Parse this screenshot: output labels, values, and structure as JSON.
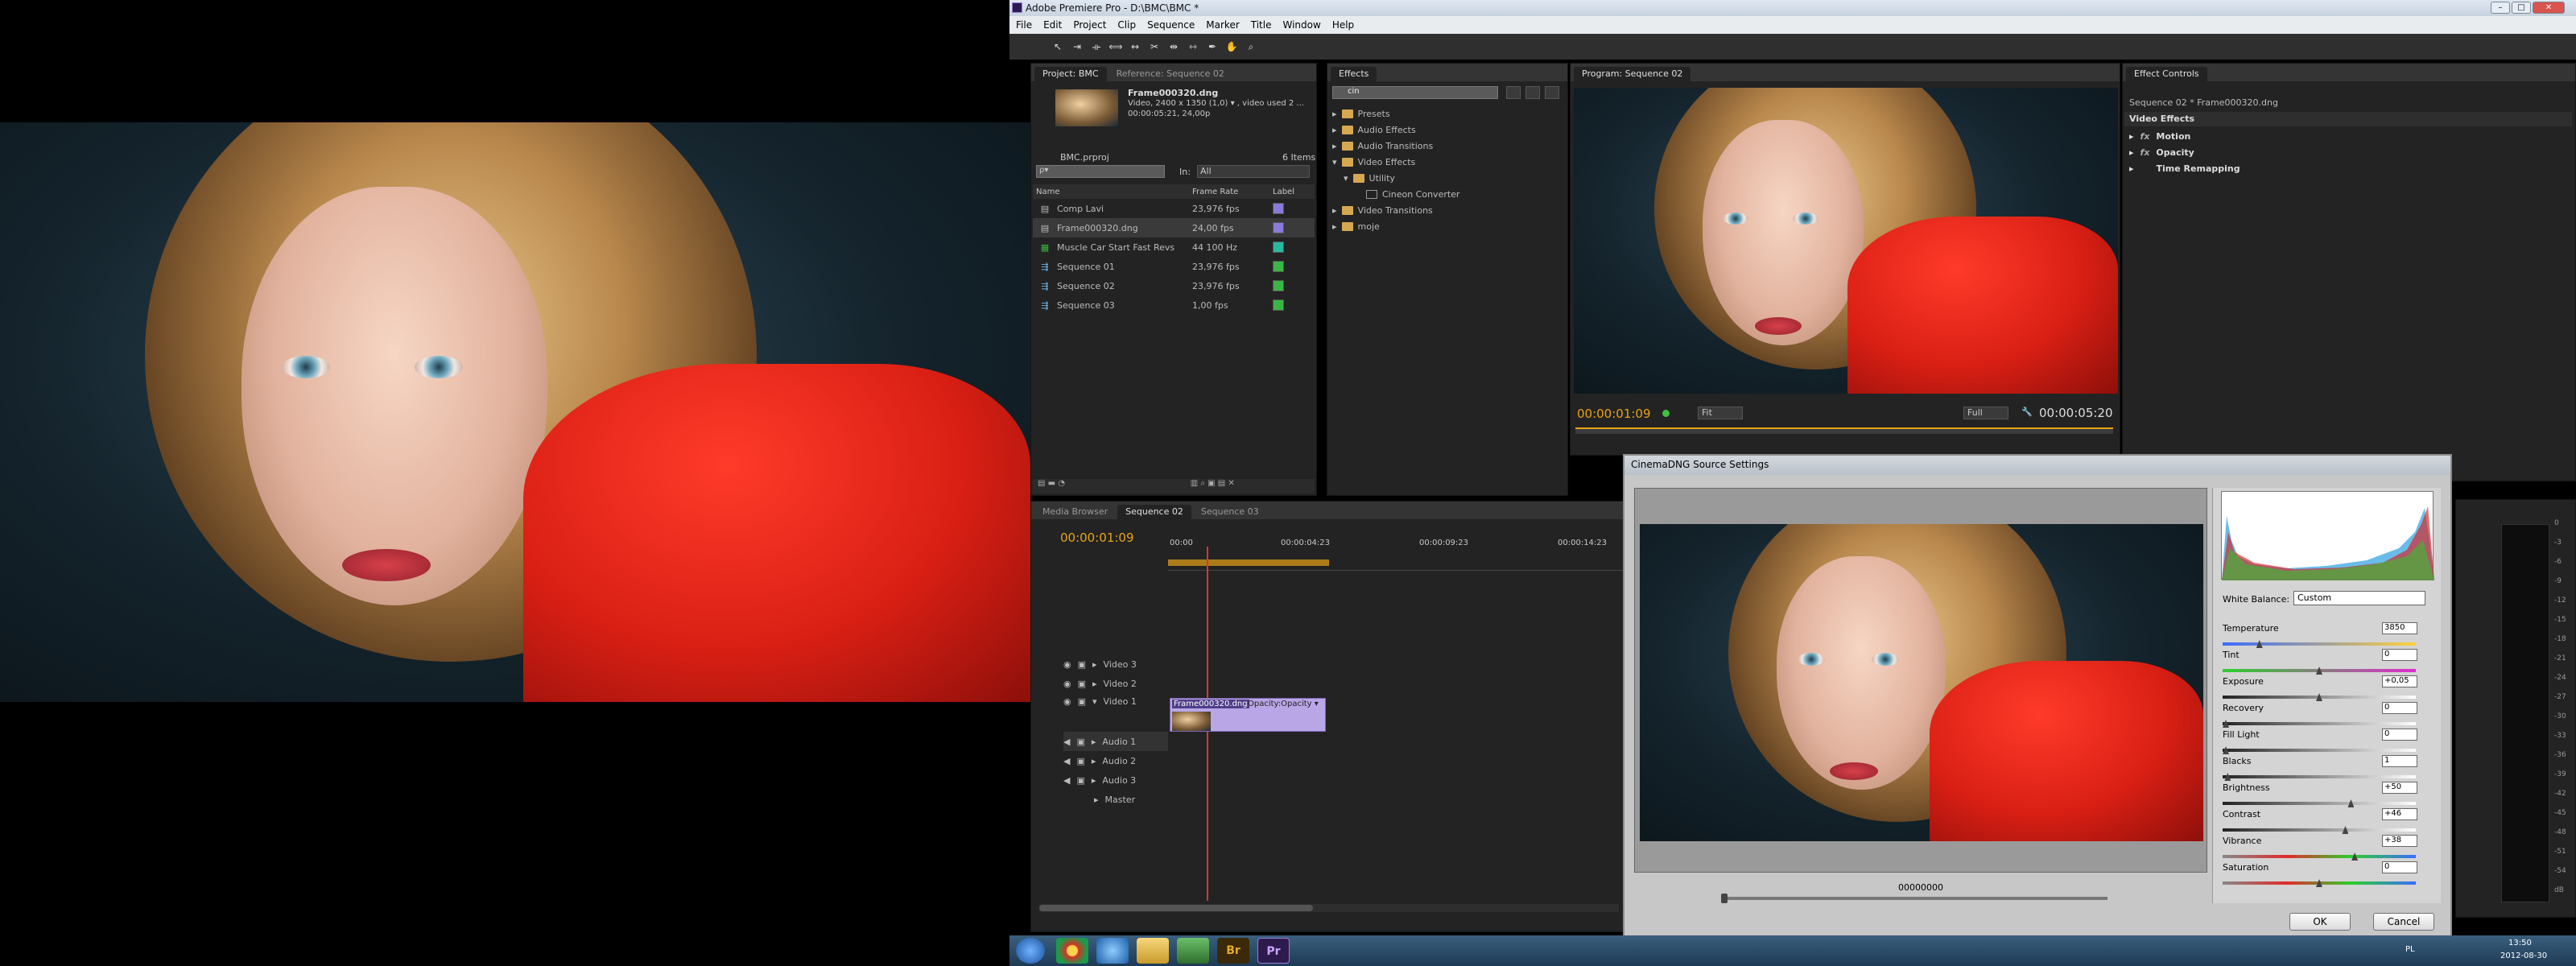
{
  "app": {
    "title": "Adobe Premiere Pro - D:\\BMC\\BMC *",
    "menu": [
      "File",
      "Edit",
      "Project",
      "Clip",
      "Sequence",
      "Marker",
      "Title",
      "Window",
      "Help"
    ],
    "window_buttons": [
      "–",
      "□",
      "✕"
    ]
  },
  "project": {
    "tabs": [
      "Project: BMC",
      "Reference: Sequence 02"
    ],
    "clip_name": "Frame000320.dng",
    "clip_info_1": "Video, 2400 x 1350 (1,0) ▾ , video used 2 ...",
    "clip_info_2": "00:00:05:21, 24,00p",
    "project_file": "BMC.prproj",
    "item_count": "6 Items",
    "search_placeholder": "ρ▾",
    "in_label": "In:",
    "in_value": "All",
    "columns": [
      "Name",
      "Frame Rate",
      "Label"
    ],
    "items": [
      {
        "name": "Comp Lavi",
        "rate": "23,976 fps",
        "color": "#8b7bd8"
      },
      {
        "name": "Frame000320.dng",
        "rate": "24,00 fps",
        "color": "#8b7bd8"
      },
      {
        "name": "Muscle Car Start Fast Revs",
        "rate": "44 100 Hz",
        "color": "#2ab9a0"
      },
      {
        "name": "Sequence 01",
        "rate": "23,976 fps",
        "color": "#3cb544"
      },
      {
        "name": "Sequence 02",
        "rate": "23,976 fps",
        "color": "#3cb544"
      },
      {
        "name": "Sequence 03",
        "rate": "1,00 fps",
        "color": "#3cb544"
      }
    ]
  },
  "effects": {
    "tab": "Effects",
    "search_value": "cin",
    "tree": [
      "Presets",
      "Audio Effects",
      "Audio Transitions",
      "Video Effects",
      "Utility",
      "Cineon Converter",
      "Video Transitions",
      "moje"
    ]
  },
  "program": {
    "tab": "Program: Sequence 02",
    "timecode_left": "00:00:01:09",
    "fit": "Fit",
    "full": "Full",
    "timecode_right": "00:00:05:20"
  },
  "effect_controls": {
    "tab": "Effect Controls",
    "sequence": "Sequence 02 * Frame000320.dng",
    "header": "Video Effects",
    "items": [
      "Motion",
      "Opacity",
      "Time Remapping"
    ]
  },
  "timeline": {
    "tabs": [
      "Media Browser",
      "Sequence 02",
      "Sequence 03"
    ],
    "timecode": "00:00:01:09",
    "ruler": [
      "00:00",
      "00:00:04:23",
      "00:00:09:23",
      "00:00:14:23"
    ],
    "tracks": [
      "Video 3",
      "Video 2",
      "Video 1",
      "Audio 1",
      "Audio 2",
      "Audio 3",
      "Master"
    ],
    "clip_label": "Frame000320.dng",
    "clip_opacity": "Opacity:Opacity ▾"
  },
  "dialog": {
    "title": "CinemaDNG Source Settings",
    "frame": "00000000",
    "white_balance_label": "White Balance:",
    "white_balance_value": "Custom",
    "sliders": [
      {
        "label": "Temperature",
        "value": "3850",
        "pos": 0.18
      },
      {
        "label": "Tint",
        "value": "0",
        "pos": 0.5
      },
      {
        "label": "Exposure",
        "value": "+0,05",
        "pos": 0.5
      },
      {
        "label": "Recovery",
        "value": "0",
        "pos": 0.0
      },
      {
        "label": "Fill Light",
        "value": "0",
        "pos": 0.0
      },
      {
        "label": "Blacks",
        "value": "1",
        "pos": 0.01
      },
      {
        "label": "Brightness",
        "value": "+50",
        "pos": 0.67
      },
      {
        "label": "Contrast",
        "value": "+46",
        "pos": 0.64
      },
      {
        "label": "Vibrance",
        "value": "+38",
        "pos": 0.69
      },
      {
        "label": "Saturation",
        "value": "0",
        "pos": 0.5
      }
    ],
    "ok": "OK",
    "cancel": "Cancel"
  },
  "meter_scale": [
    "0",
    "-3",
    "-6",
    "-9",
    "-12",
    "-15",
    "-18",
    "-21",
    "-24",
    "-27",
    "-30",
    "-33",
    "-36",
    "-39",
    "-42",
    "-45",
    "-48",
    "-51",
    "-54",
    "dB"
  ],
  "taskbar": {
    "time": "13:50",
    "date": "2012-08-30",
    "lang": "PL"
  },
  "colors": {
    "accent": "#e8a317",
    "panel": "#232323",
    "timecode": "#e8a317"
  }
}
